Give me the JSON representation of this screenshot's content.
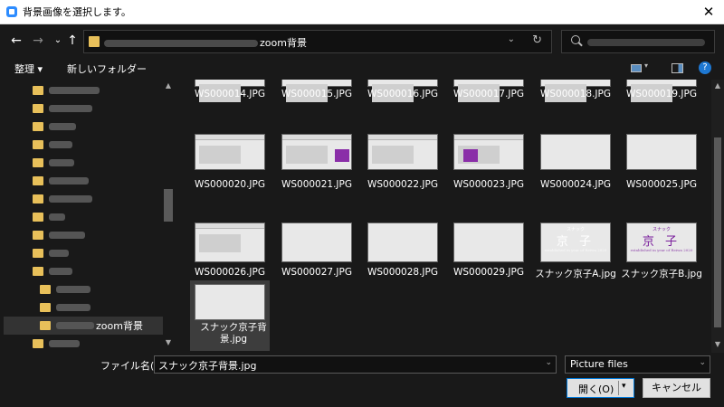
{
  "window": {
    "title": "背景画像を選択します。",
    "close_glyph": "✕"
  },
  "nav": {
    "back": "←",
    "forward": "→",
    "recent": "⌄",
    "up": "↑"
  },
  "address": {
    "path_suffix": "zoom背景",
    "dropdown": "⌄",
    "refresh": "↻"
  },
  "toolbar": {
    "organize": "整理 ▾",
    "new_folder": "新しいフォルダー",
    "help": "?"
  },
  "sidebar": {
    "selected_label": "zoom背景"
  },
  "files": [
    {
      "name": "WS000014.JPG",
      "kind": "shot"
    },
    {
      "name": "WS000015.JPG",
      "kind": "shot"
    },
    {
      "name": "WS000016.JPG",
      "kind": "shot"
    },
    {
      "name": "WS000017.JPG",
      "kind": "shot"
    },
    {
      "name": "WS000018.JPG",
      "kind": "shot"
    },
    {
      "name": "WS000019.JPG",
      "kind": "shot"
    },
    {
      "name": "WS000020.JPG",
      "kind": "shot"
    },
    {
      "name": "WS000021.JPG",
      "kind": "shot"
    },
    {
      "name": "WS000022.JPG",
      "kind": "shot"
    },
    {
      "name": "WS000023.JPG",
      "kind": "shot"
    },
    {
      "name": "WS000024.JPG",
      "kind": "checker"
    },
    {
      "name": "WS000025.JPG",
      "kind": "checker"
    },
    {
      "name": "WS000026.JPG",
      "kind": "shot"
    },
    {
      "name": "WS000027.JPG",
      "kind": "checker"
    },
    {
      "name": "WS000028.JPG",
      "kind": "checker"
    },
    {
      "name": "WS000029.JPG",
      "kind": "checker"
    },
    {
      "name": "スナック京子A.jpg",
      "kind": "sign-purple"
    },
    {
      "name": "スナック京子B.jpg",
      "kind": "sign-white"
    },
    {
      "name": "スナック京子背景.jpg",
      "kind": "checker",
      "selected": true
    }
  ],
  "signs": {
    "top": "スナック",
    "title": "京 子",
    "sub": "established in year of Reiwa 2020"
  },
  "bottom": {
    "filename_label": "ファイル名(N):",
    "filename_value": "スナック京子背景.jpg",
    "filetype_value": "Picture files",
    "open_label": "開く(O)",
    "cancel_label": "キャンセル"
  }
}
